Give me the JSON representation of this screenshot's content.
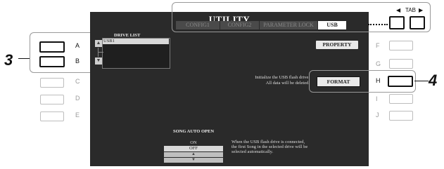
{
  "screen": {
    "title": "UTILITY",
    "tabs": [
      "CONFIG1",
      "CONFIG2",
      "PARAMETER LOCK",
      "USB"
    ],
    "active_tab": "USB"
  },
  "tab_control": {
    "label": "TAB"
  },
  "drive_list": {
    "header": "DRIVE LIST",
    "items": [
      "USB1"
    ],
    "selected": "USB1"
  },
  "buttons": {
    "property": "PROPERTY",
    "format": "FORMAT"
  },
  "format_message": [
    "Initialize the USB flash drive.",
    "All data will be deleted."
  ],
  "song_auto_open": {
    "header": "SONG AUTO OPEN",
    "options": [
      "ON",
      "OFF"
    ],
    "selected": "OFF",
    "description": [
      "When the USB flash drive is connected,",
      "the first Song in the selected drive will be",
      "selected automatically."
    ]
  },
  "left_labels": [
    "A",
    "B",
    "C",
    "D",
    "E"
  ],
  "right_labels": [
    "F",
    "G",
    "H",
    "I",
    "J"
  ],
  "callouts": {
    "left": "3",
    "right": "4"
  }
}
